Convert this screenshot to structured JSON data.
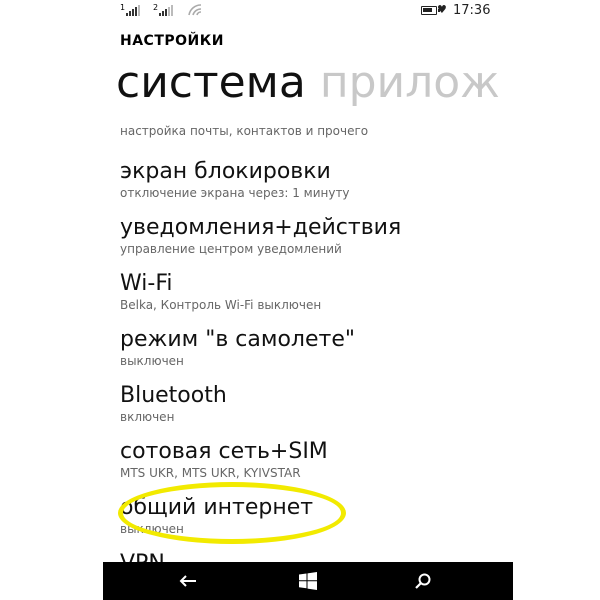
{
  "status_bar": {
    "sim1": "1",
    "sim2": "2",
    "time": "17:36"
  },
  "header": {
    "app_title": "НАСТРОЙКИ",
    "pivot_active": "система",
    "pivot_next": "прилож"
  },
  "settings": [
    {
      "title": "",
      "subtitle": "настройка почты, контактов и прочего"
    },
    {
      "title": "экран блокировки",
      "subtitle": "отключение экрана через: 1 минуту"
    },
    {
      "title": "уведомления+действия",
      "subtitle": "управление центром уведомлений"
    },
    {
      "title": "Wi-Fi",
      "subtitle": "Belka, Контроль Wi-Fi выключен"
    },
    {
      "title": "режим \"в самолете\"",
      "subtitle": "выключен"
    },
    {
      "title": "Bluetooth",
      "subtitle": "включен"
    },
    {
      "title": "сотовая сеть+SIM",
      "subtitle": "MTS UKR, MTS UKR, KYIVSTAR"
    },
    {
      "title": "общий интернет",
      "subtitle": "выключен"
    },
    {
      "title": "VPN",
      "subtitle": ""
    }
  ],
  "colors": {
    "highlight": "#f2ea00",
    "inactive_pivot": "#c8c8c8",
    "navbar": "#000000"
  },
  "icons": [
    "signal-icon",
    "wifi-icon",
    "battery-icon",
    "battery-saver-icon",
    "back-icon",
    "windows-icon",
    "search-icon"
  ]
}
